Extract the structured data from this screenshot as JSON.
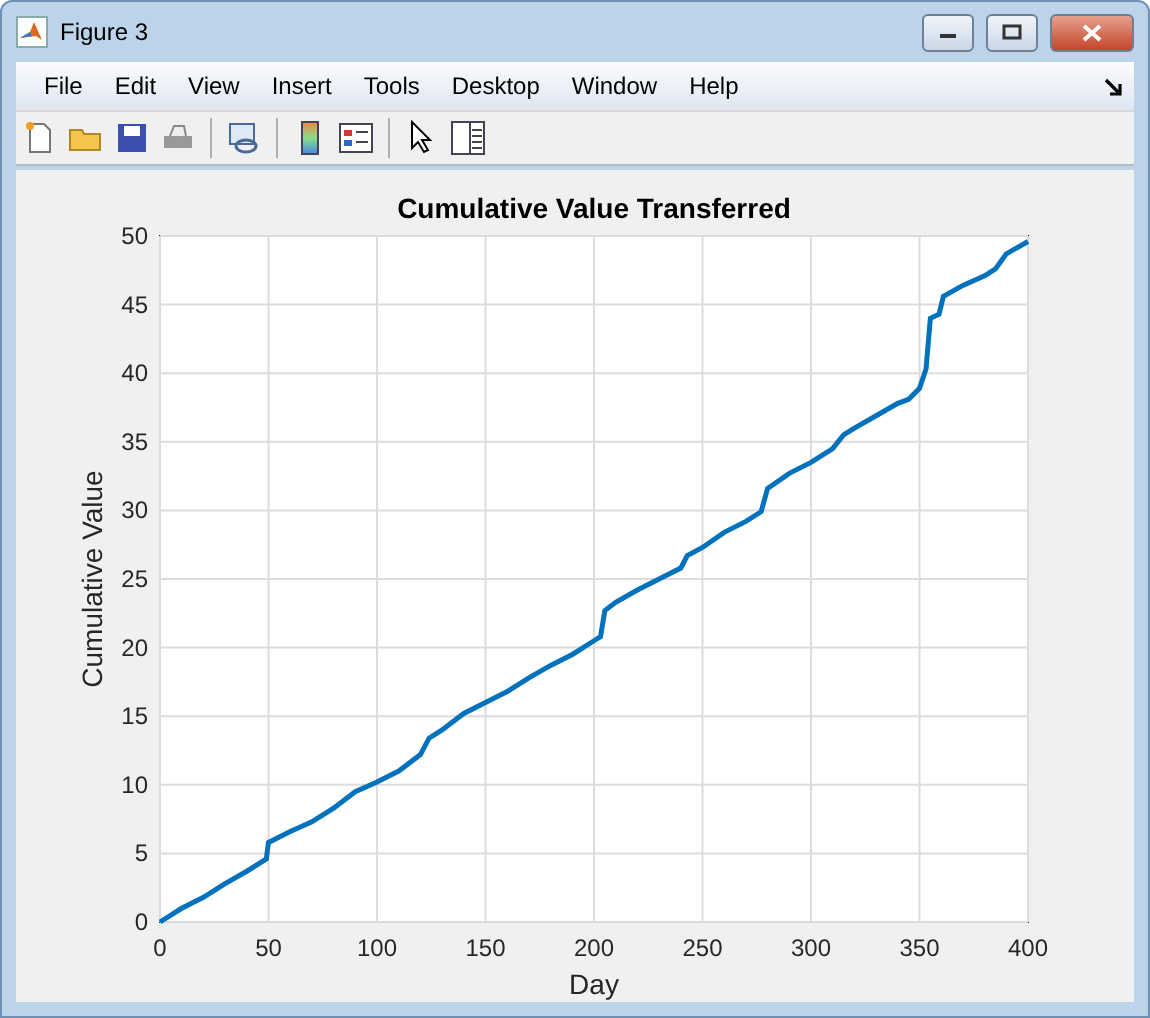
{
  "window": {
    "title": "Figure 3"
  },
  "menu": [
    "File",
    "Edit",
    "View",
    "Insert",
    "Tools",
    "Desktop",
    "Window",
    "Help"
  ],
  "figure": {
    "chart_data": {
      "type": "line",
      "grid": true,
      "title": "Cumulative Value Transferred",
      "xlabel": "Day",
      "ylabel": "Cumulative Value",
      "xlim": [
        0,
        400
      ],
      "ylim": [
        0,
        50
      ],
      "xticks": [
        0,
        50,
        100,
        150,
        200,
        250,
        300,
        350,
        400
      ],
      "yticks": [
        0,
        5,
        10,
        15,
        20,
        25,
        30,
        35,
        40,
        45,
        50
      ],
      "x": [
        0,
        10,
        20,
        30,
        40,
        49,
        50,
        60,
        70,
        80,
        90,
        100,
        110,
        120,
        124,
        130,
        140,
        150,
        160,
        170,
        180,
        190,
        200,
        203,
        205,
        210,
        220,
        230,
        240,
        243,
        250,
        260,
        270,
        277,
        280,
        290,
        300,
        310,
        315,
        320,
        330,
        340,
        345,
        350,
        353,
        355,
        359,
        361,
        370,
        380,
        385,
        390,
        400
      ],
      "series": [
        {
          "color": "#0072bd",
          "values": [
            0,
            1,
            1.8,
            2.8,
            3.7,
            4.6,
            5.8,
            6.6,
            7.3,
            8.3,
            9.5,
            10.2,
            11,
            12.2,
            13.4,
            14,
            15.2,
            16,
            16.8,
            17.8,
            18.7,
            19.5,
            20.5,
            20.8,
            22.7,
            23.3,
            24.2,
            25,
            25.8,
            26.7,
            27.3,
            28.4,
            29.2,
            29.9,
            31.6,
            32.7,
            33.5,
            34.5,
            35.5,
            36,
            36.9,
            37.8,
            38.1,
            38.9,
            40.3,
            44,
            44.3,
            45.6,
            46.4,
            47.1,
            47.6,
            48.7,
            49.6
          ]
        }
      ]
    }
  }
}
